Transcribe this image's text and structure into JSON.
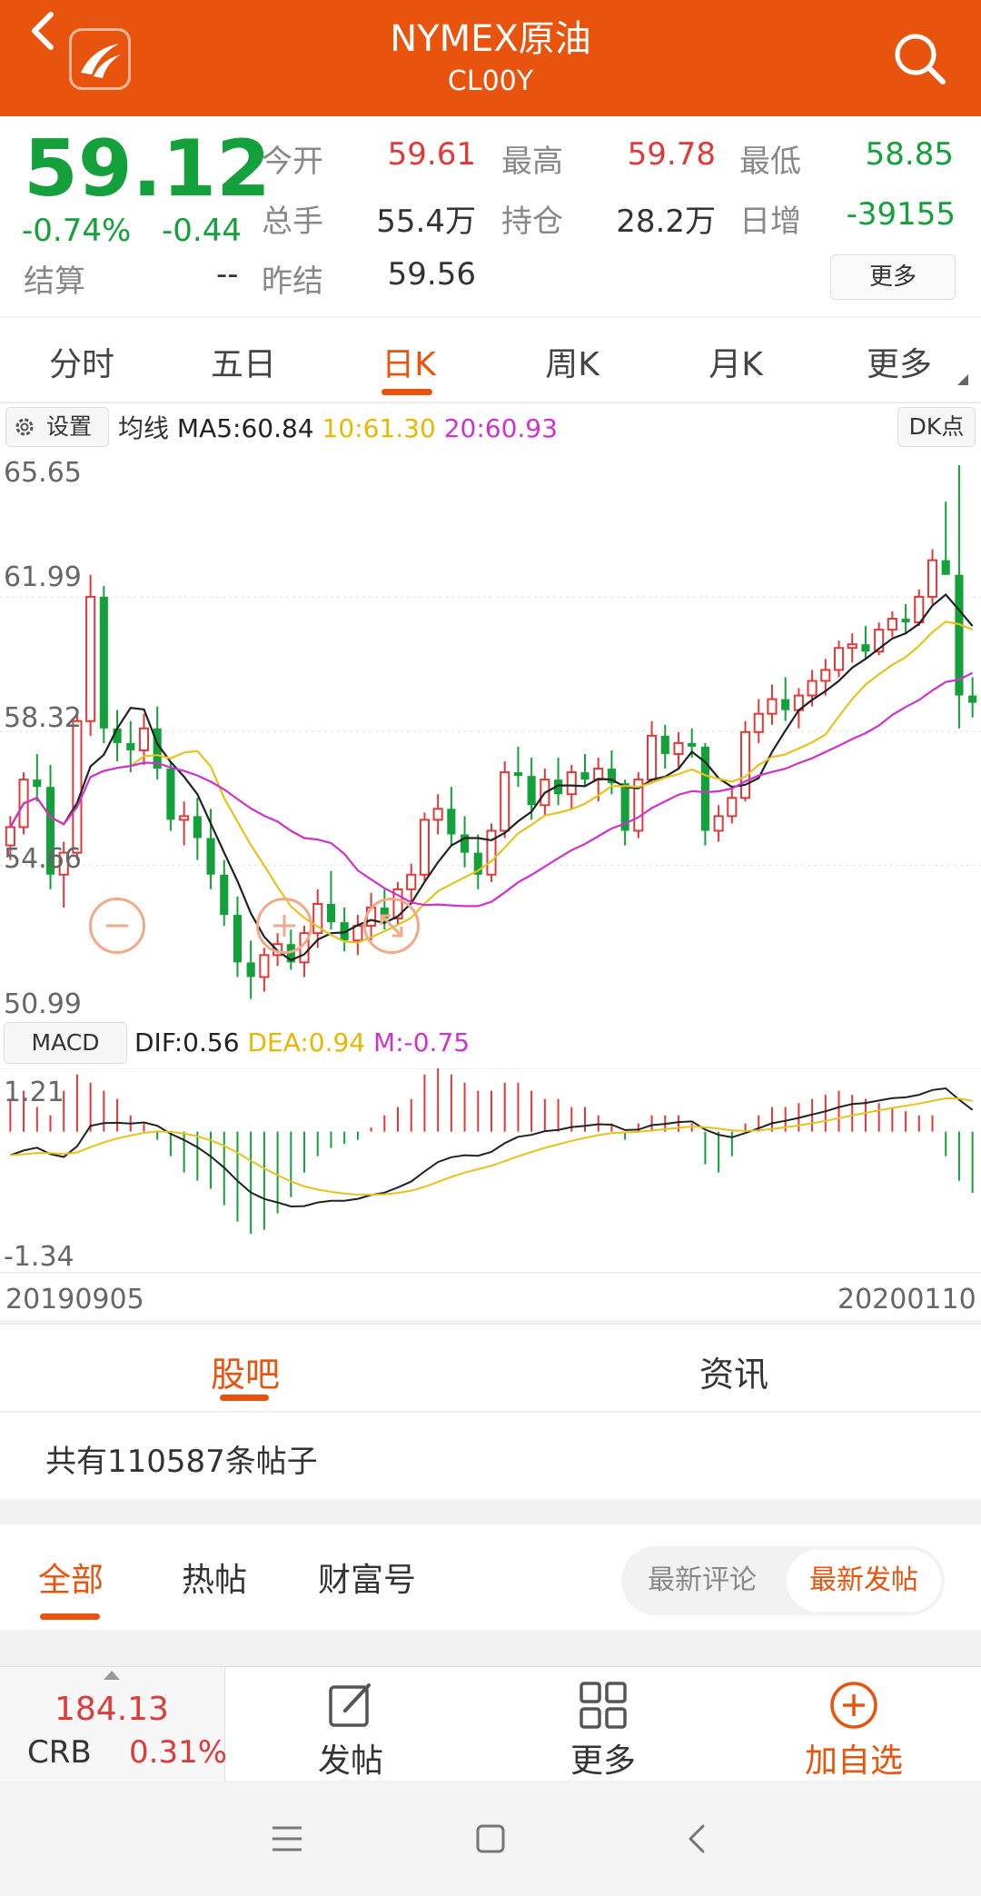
{
  "header": {
    "title": "NYMEX原油",
    "subtitle": "CL00Y",
    "icons": {
      "back": "back-arrow-icon",
      "logo": "app-logo-icon",
      "search": "search-icon"
    }
  },
  "quote": {
    "price": "59.12",
    "change_pct": "-0.74%",
    "change": "-0.44",
    "settle_label": "结算",
    "settle_value": "--",
    "stats": [
      {
        "label": "今开",
        "value": "59.61",
        "color": "#e0393a"
      },
      {
        "label": "最高",
        "value": "59.78",
        "color": "#e0393a"
      },
      {
        "label": "最低",
        "value": "58.85",
        "color": "#14a03b"
      },
      {
        "label": "总手",
        "value": "55.4万",
        "color": "#333333"
      },
      {
        "label": "持仓",
        "value": "28.2万",
        "color": "#333333"
      },
      {
        "label": "日增",
        "value": "-39155",
        "color": "#14a03b"
      },
      {
        "label": "昨结",
        "value": "59.56",
        "color": "#333333"
      }
    ],
    "more_label": "更多"
  },
  "period_tabs": [
    "分时",
    "五日",
    "日K",
    "周K",
    "月K",
    "更多"
  ],
  "active_period": 2,
  "chart": {
    "settings_label": "设置",
    "ma_label": "均线",
    "ma5": "MA5:60.84",
    "ma10": "10:61.30",
    "ma20": "20:60.93",
    "dk_label": "DK点",
    "macd_label": "MACD",
    "dif": "DIF:0.56",
    "dea": "DEA:0.94",
    "m": "M:-0.75",
    "date_start": "20190905",
    "date_end": "20200110"
  },
  "chart_data": [
    {
      "type": "candlestick",
      "ylim": [
        50.99,
        65.65
      ],
      "yticks": [
        "65.65",
        "61.99",
        "58.32",
        "54.66",
        "50.99"
      ],
      "x_range": [
        "20190905",
        "20200110"
      ],
      "series": [
        {
          "name": "MA5",
          "color": "#222222"
        },
        {
          "name": "10",
          "color": "#e6c21e"
        },
        {
          "name": "20",
          "color": "#cc33cc"
        }
      ],
      "candles": [
        [
          55.2,
          56.0,
          54.8,
          55.7
        ],
        [
          55.7,
          57.2,
          55.5,
          57.0
        ],
        [
          57.0,
          57.7,
          56.4,
          56.8
        ],
        [
          56.8,
          57.4,
          54.0,
          54.4
        ],
        [
          54.4,
          55.3,
          53.5,
          55.0
        ],
        [
          55.0,
          58.9,
          54.8,
          58.6
        ],
        [
          58.6,
          62.6,
          58.2,
          62.0
        ],
        [
          62.0,
          62.3,
          58.0,
          58.4
        ],
        [
          58.4,
          58.9,
          57.5,
          58.0
        ],
        [
          58.0,
          58.6,
          57.2,
          57.8
        ],
        [
          57.8,
          58.8,
          57.4,
          58.4
        ],
        [
          58.4,
          59.0,
          57.0,
          57.3
        ],
        [
          57.3,
          57.5,
          55.6,
          55.9
        ],
        [
          55.9,
          56.4,
          55.2,
          56.0
        ],
        [
          56.0,
          56.5,
          54.8,
          55.4
        ],
        [
          55.4,
          56.2,
          54.0,
          54.4
        ],
        [
          54.4,
          54.8,
          53.0,
          53.3
        ],
        [
          53.3,
          53.8,
          51.6,
          52.0
        ],
        [
          52.0,
          52.6,
          51.0,
          51.6
        ],
        [
          51.6,
          52.4,
          51.2,
          52.2
        ],
        [
          52.2,
          52.8,
          51.9,
          52.5
        ],
        [
          52.5,
          52.9,
          51.8,
          52.0
        ],
        [
          52.0,
          53.0,
          51.6,
          52.8
        ],
        [
          52.8,
          54.0,
          52.4,
          53.6
        ],
        [
          53.6,
          54.5,
          52.9,
          53.1
        ],
        [
          53.1,
          53.5,
          52.3,
          52.6
        ],
        [
          52.6,
          53.3,
          52.2,
          53.0
        ],
        [
          53.0,
          53.9,
          52.6,
          53.5
        ],
        [
          53.5,
          54.0,
          52.9,
          53.2
        ],
        [
          53.2,
          54.2,
          53.0,
          54.0
        ],
        [
          54.0,
          54.7,
          53.6,
          54.4
        ],
        [
          54.4,
          56.1,
          54.2,
          55.9
        ],
        [
          55.9,
          56.6,
          55.5,
          56.2
        ],
        [
          56.2,
          56.8,
          55.2,
          55.5
        ],
        [
          55.5,
          56.0,
          54.6,
          55.0
        ],
        [
          55.0,
          55.5,
          54.0,
          54.4
        ],
        [
          54.4,
          55.8,
          54.2,
          55.6
        ],
        [
          55.6,
          57.5,
          55.4,
          57.2
        ],
        [
          57.2,
          57.9,
          56.8,
          57.1
        ],
        [
          57.1,
          57.6,
          55.9,
          56.3
        ],
        [
          56.3,
          57.3,
          56.0,
          57.0
        ],
        [
          57.0,
          57.6,
          56.3,
          56.6
        ],
        [
          56.6,
          57.4,
          56.2,
          57.2
        ],
        [
          57.2,
          57.7,
          56.8,
          57.0
        ],
        [
          57.0,
          57.6,
          56.4,
          57.3
        ],
        [
          57.3,
          57.8,
          56.6,
          56.9
        ],
        [
          56.9,
          57.0,
          55.2,
          55.6
        ],
        [
          55.6,
          57.2,
          55.4,
          57.0
        ],
        [
          57.0,
          58.6,
          56.9,
          58.2
        ],
        [
          58.2,
          58.5,
          57.3,
          57.7
        ],
        [
          57.7,
          58.3,
          57.3,
          58.0
        ],
        [
          58.0,
          58.4,
          57.6,
          57.9
        ],
        [
          57.9,
          58.0,
          55.2,
          55.6
        ],
        [
          55.6,
          56.3,
          55.3,
          56.0
        ],
        [
          56.0,
          56.8,
          55.8,
          56.5
        ],
        [
          56.5,
          58.6,
          56.4,
          58.3
        ],
        [
          58.3,
          59.2,
          58.0,
          58.8
        ],
        [
          58.8,
          59.6,
          58.5,
          59.2
        ],
        [
          59.2,
          59.8,
          58.6,
          58.9
        ],
        [
          58.9,
          59.5,
          58.4,
          59.3
        ],
        [
          59.3,
          60.0,
          59.0,
          59.7
        ],
        [
          59.7,
          60.3,
          59.3,
          60.0
        ],
        [
          60.0,
          60.8,
          59.8,
          60.6
        ],
        [
          60.6,
          61.0,
          60.2,
          60.7
        ],
        [
          60.7,
          61.2,
          60.3,
          60.5
        ],
        [
          60.5,
          61.3,
          60.4,
          61.1
        ],
        [
          61.1,
          61.6,
          60.9,
          61.4
        ],
        [
          61.4,
          61.8,
          61.0,
          61.3
        ],
        [
          61.3,
          62.2,
          61.2,
          62.0
        ],
        [
          62.0,
          63.3,
          61.8,
          63.0
        ],
        [
          63.0,
          64.6,
          62.6,
          62.6
        ],
        [
          62.6,
          65.6,
          58.4,
          59.3
        ],
        [
          59.3,
          59.8,
          58.7,
          59.1
        ]
      ]
    },
    {
      "type": "bar",
      "name": "MACD",
      "ylim": [
        -1.34,
        1.21
      ],
      "yticks": [
        "1.21",
        "-1.34"
      ],
      "series": [
        {
          "name": "DIF",
          "color": "#222222"
        },
        {
          "name": "DEA",
          "color": "#e6c21e"
        },
        {
          "name": "M",
          "color": "#cc33cc"
        }
      ],
      "m_values": [
        0.4,
        0.5,
        0.3,
        0.2,
        0.5,
        0.7,
        0.6,
        0.5,
        0.4,
        0.2,
        0.1,
        -0.1,
        -0.3,
        -0.5,
        -0.6,
        -0.7,
        -0.9,
        -1.1,
        -1.25,
        -1.2,
        -1.0,
        -0.8,
        -0.5,
        -0.3,
        -0.2,
        -0.15,
        -0.1,
        0.05,
        0.2,
        0.3,
        0.4,
        0.7,
        0.8,
        0.7,
        0.6,
        0.5,
        0.5,
        0.6,
        0.6,
        0.5,
        0.4,
        0.4,
        0.3,
        0.3,
        0.2,
        0.1,
        -0.1,
        0.1,
        0.2,
        0.2,
        0.2,
        0.1,
        -0.4,
        -0.5,
        -0.3,
        0.1,
        0.2,
        0.3,
        0.3,
        0.35,
        0.4,
        0.45,
        0.5,
        0.45,
        0.4,
        0.35,
        0.3,
        0.25,
        0.2,
        0.2,
        -0.3,
        -0.6,
        -0.75
      ]
    }
  ],
  "forum_tabs": [
    "股吧",
    "资讯"
  ],
  "post_count": "共有110587条帖子",
  "filters": [
    "全部",
    "热帖",
    "财富号"
  ],
  "sort_options": [
    "最新评论",
    "最新发帖"
  ],
  "bottom_bar": {
    "crb_value": "184.13",
    "crb_label": "CRB",
    "crb_change": "0.31%",
    "actions": [
      {
        "label": "发帖",
        "icon": "edit-icon"
      },
      {
        "label": "更多",
        "icon": "grid-icon"
      },
      {
        "label": "加自选",
        "icon": "add-circle-icon"
      }
    ]
  },
  "colors": {
    "accent": "#e8540e",
    "up": "#e0393a",
    "down": "#14a03b"
  }
}
